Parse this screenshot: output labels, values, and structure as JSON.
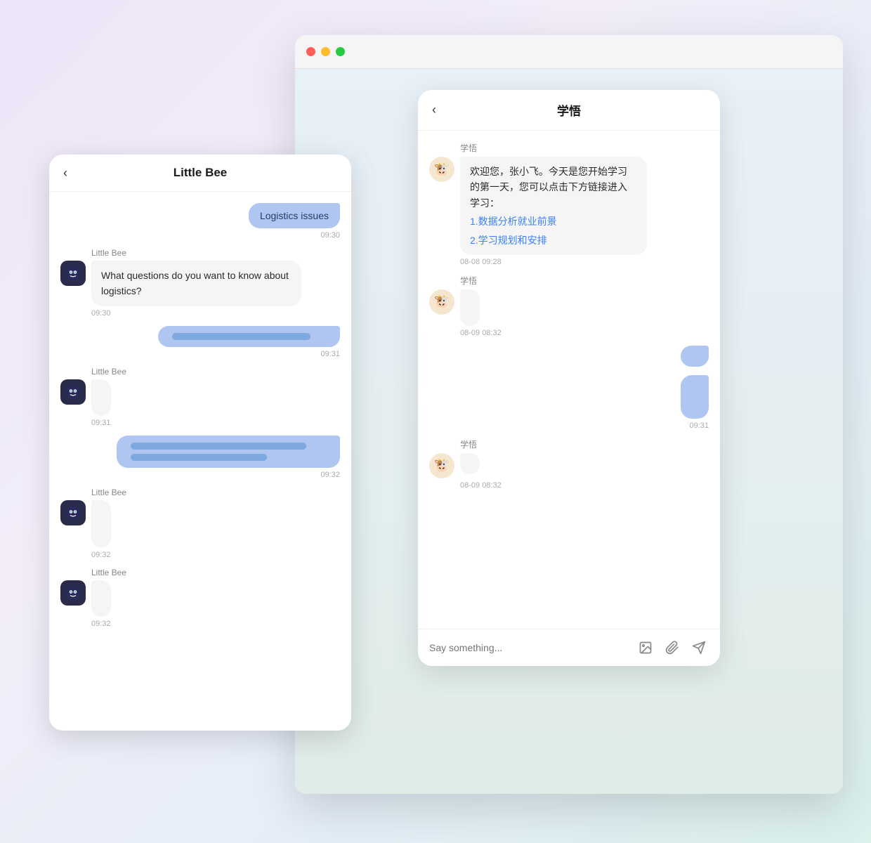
{
  "browser": {
    "titlebar": {
      "traffic_red": "close",
      "traffic_yellow": "minimize",
      "traffic_green": "fullscreen"
    }
  },
  "phone_littlebee": {
    "header": {
      "back_label": "‹",
      "title": "Little Bee"
    },
    "messages": [
      {
        "type": "user",
        "text": "Logistics issues",
        "time": "09:30"
      },
      {
        "type": "bot",
        "sender": "Little Bee",
        "text": "What questions do you want to know about logistics?",
        "time": "09:30"
      },
      {
        "type": "user",
        "skeleton": true,
        "time": "09:31"
      },
      {
        "type": "bot",
        "sender": "Little Bee",
        "skeleton": true,
        "time": "09:31"
      },
      {
        "type": "user",
        "skeleton": true,
        "time": "09:32"
      },
      {
        "type": "bot",
        "sender": "Little Bee",
        "skeleton": true,
        "time": "09:32"
      },
      {
        "type": "bot",
        "sender": "Little Bee",
        "skeleton": true,
        "time": "09:32"
      }
    ]
  },
  "phone_xuewu": {
    "header": {
      "back_label": "‹",
      "title": "学悟"
    },
    "messages": [
      {
        "type": "bot",
        "sender": "学悟",
        "greeting": "欢迎您，张小飞。今天是您开始学习的第一天，您可以点击下方链接进入学习：",
        "links": [
          "1.数据分析就业前景",
          "2.学习规划和安排"
        ],
        "time": "08-08 09:28"
      },
      {
        "type": "bot",
        "sender": "学悟",
        "skeleton": true,
        "time": "08-09 08:32"
      },
      {
        "type": "user",
        "skeleton": true,
        "time": "09:31"
      },
      {
        "type": "user",
        "skeleton2": true,
        "time": "09:31"
      },
      {
        "type": "bot",
        "sender": "学悟",
        "skeleton": true,
        "time": "08-09 08:32"
      }
    ],
    "input_placeholder": "Say something...",
    "icons": {
      "image": "image-icon",
      "attach": "paperclip-icon",
      "send": "send-icon"
    }
  }
}
